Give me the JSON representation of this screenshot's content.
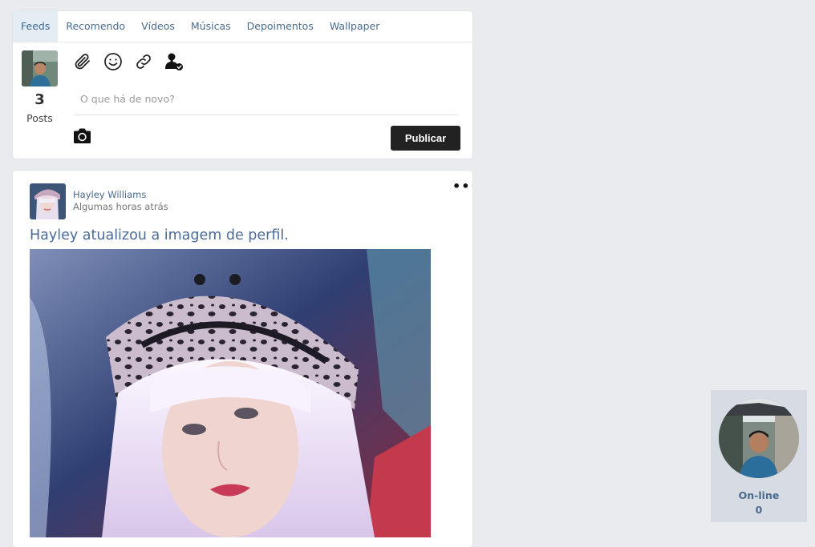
{
  "composer": {
    "tabs": [
      {
        "label": "Feeds",
        "active": true
      },
      {
        "label": "Recomendo"
      },
      {
        "label": "Vídeos"
      },
      {
        "label": "Músicas"
      },
      {
        "label": "Depoimentos"
      },
      {
        "label": "Wallpaper"
      }
    ],
    "posts_count": "3",
    "posts_label": "Posts",
    "tools": [
      "paperclip-icon",
      "smiley-icon",
      "link-icon",
      "user-check-icon"
    ],
    "status_placeholder": "O que há de novo?",
    "publish_label": "Publicar"
  },
  "post": {
    "author": "Hayley Williams",
    "time": "Algumas horas atrás",
    "text": "Hayley atualizou a imagem de perfil."
  },
  "online": {
    "label": "On-line",
    "count": "0"
  },
  "colors": {
    "background": "#e9ebee",
    "accent": "#4a6b8e",
    "button": "#222222"
  }
}
